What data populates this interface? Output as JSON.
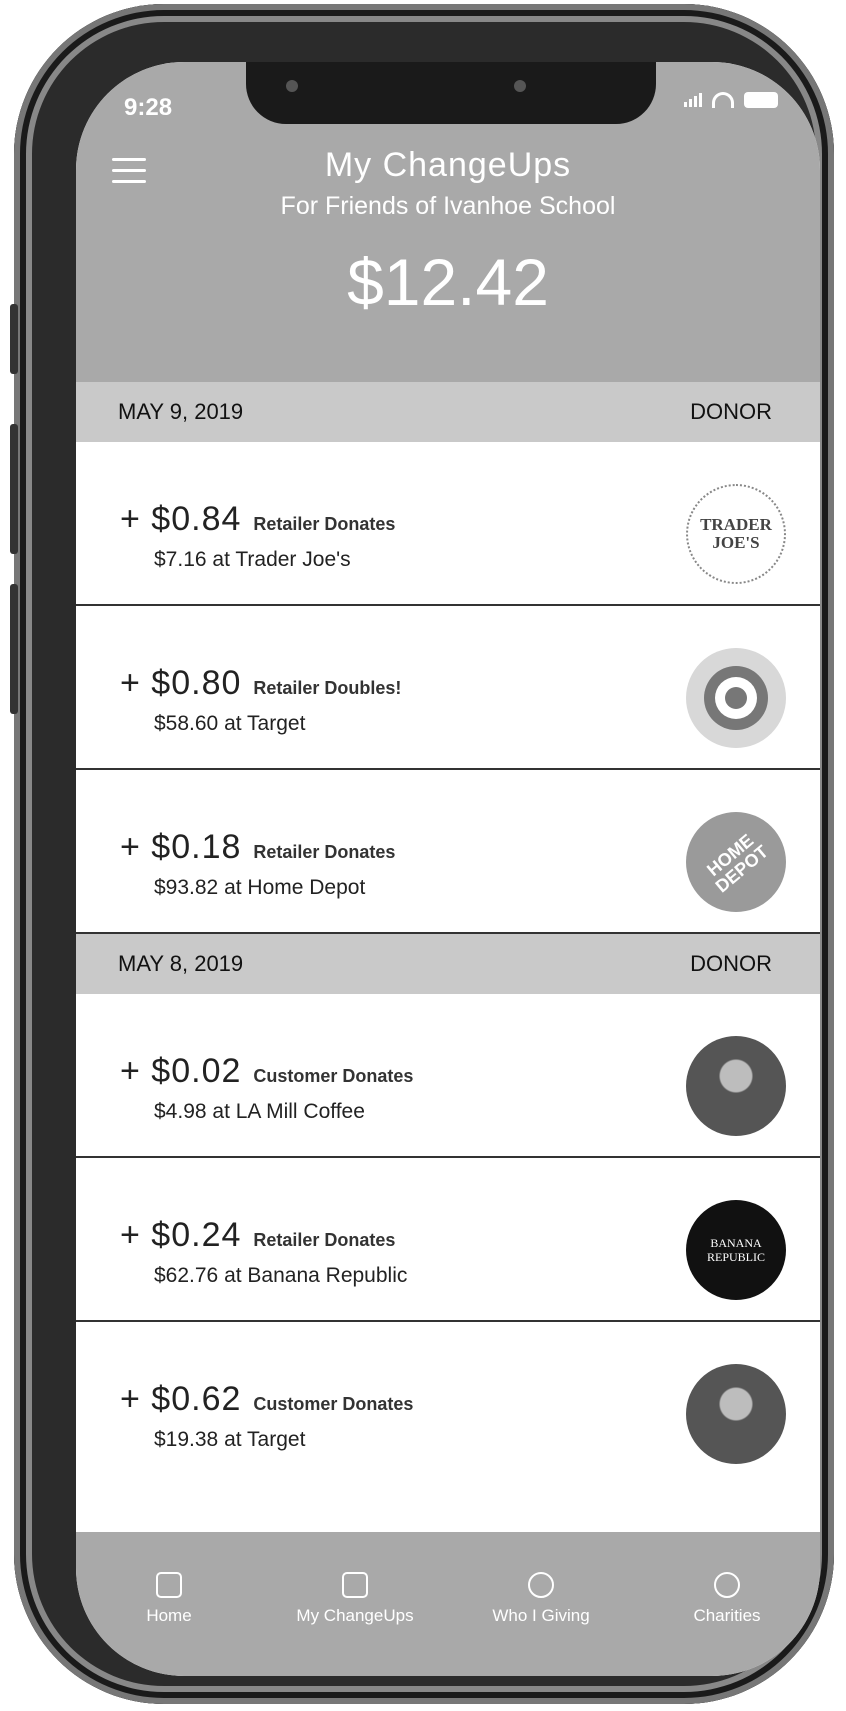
{
  "status_bar": {
    "time": "9:28"
  },
  "header": {
    "title": "My ChangeUps",
    "subtitle": "For Friends of Ivanhoe School",
    "total": "$12.42"
  },
  "sections": [
    {
      "date": "MAY 9, 2019",
      "col_label": "DONOR"
    },
    {
      "date": "MAY 8, 2019",
      "col_label": "DONOR"
    }
  ],
  "transactions": [
    {
      "amount": "+ $0.84",
      "kind": "Retailer Donates",
      "detail": "$7.16 at Trader Joe's",
      "logo_text": "TRADER JOE'S",
      "logo": "trader-joes-logo"
    },
    {
      "amount": "+ $0.80",
      "kind": "Retailer Doubles!",
      "detail": "$58.60 at Target",
      "logo": "target-logo"
    },
    {
      "amount": "+ $0.18",
      "kind": "Retailer Donates",
      "detail": "$93.82 at Home Depot",
      "logo_text": "HOME DEPOT",
      "logo": "home-depot-logo"
    },
    {
      "amount": "+ $0.02",
      "kind": "Customer Donates",
      "detail": "$4.98 at LA Mill Coffee",
      "logo": "donor-avatar"
    },
    {
      "amount": "+ $0.24",
      "kind": "Retailer Donates",
      "detail": "$62.76 at Banana Republic",
      "logo_text": "BANANA REPUBLIC",
      "logo": "banana-republic-logo"
    },
    {
      "amount": "+ $0.62",
      "kind": "Customer Donates",
      "detail": "$19.38 at Target",
      "logo": "donor-avatar"
    }
  ],
  "tabs": [
    {
      "label": "Home",
      "icon": "home-icon"
    },
    {
      "label": "My ChangeUps",
      "icon": "changeups-icon"
    },
    {
      "label": "Who I Giving",
      "icon": "giving-icon"
    },
    {
      "label": "Charities",
      "icon": "charities-icon"
    }
  ],
  "colors": {
    "header_bg": "#a9a9a9",
    "section_bg": "#c9c9c9",
    "tabbar_bg": "#a9a9a9"
  }
}
